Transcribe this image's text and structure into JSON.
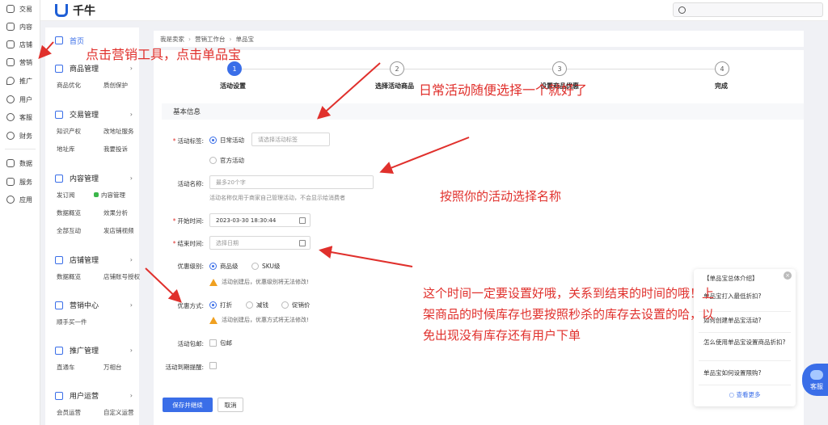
{
  "rail": {
    "items": [
      {
        "label": "交易",
        "icon": "order-icon"
      },
      {
        "label": "内容",
        "icon": "content-icon"
      },
      {
        "label": "店铺",
        "icon": "shop-icon"
      },
      {
        "label": "营销",
        "icon": "megaphone-icon"
      },
      {
        "label": "推广",
        "icon": "location-icon"
      },
      {
        "label": "用户",
        "icon": "user-icon"
      },
      {
        "label": "客服",
        "icon": "headset-icon"
      },
      {
        "label": "财务",
        "icon": "finance-icon"
      },
      {
        "label": "数据",
        "icon": "chart-icon"
      },
      {
        "label": "服务",
        "icon": "grid-icon"
      },
      {
        "label": "应用",
        "icon": "apps-icon"
      }
    ]
  },
  "topbar": {
    "brand": "千牛"
  },
  "menu": {
    "home": "首页",
    "groups": [
      {
        "title": "商品管理",
        "subs": [
          "商品优化",
          "质创保护"
        ]
      },
      {
        "title": "交易管理",
        "subs": [
          "知识产权",
          "改地址服务",
          "地址库",
          "我要投诉"
        ]
      },
      {
        "title": "内容管理",
        "subs": [
          "发订阅",
          "内容管理",
          "数据概览",
          "效果分析",
          "全部互动",
          "发店铺视频"
        ]
      },
      {
        "title": "店铺管理",
        "subs": [
          "数据概览",
          "店铺账号授权"
        ]
      },
      {
        "title": "营销中心",
        "subs": [
          "顺手买一件"
        ]
      },
      {
        "title": "推广管理",
        "subs": [
          "直通车",
          "万相台"
        ]
      },
      {
        "title": "用户运营",
        "subs": [
          "会员运营",
          "自定义运营"
        ]
      }
    ]
  },
  "breadcrumb": [
    "我是卖家",
    "营销工作台",
    "单品宝"
  ],
  "steps": [
    {
      "num": "1",
      "label": "活动设置"
    },
    {
      "num": "2",
      "label": "选择活动商品"
    },
    {
      "num": "3",
      "label": "设置商品优惠"
    },
    {
      "num": "4",
      "label": "完成"
    }
  ],
  "form": {
    "section": "基本信息",
    "tag_label": "活动标签:",
    "tag_opt1": "日常活动",
    "tag_opt2": "官方活动",
    "tag_placeholder": "请选择活动标签",
    "name_label": "活动名称:",
    "name_placeholder": "最多20个字",
    "name_hint": "活动名称仅用于商家自己管理活动，不会显示给消费者",
    "start_label": "开始时间:",
    "start_value": "2023-03-30 18:30:44",
    "end_label": "结束时间:",
    "end_placeholder": "选择日期",
    "level_label": "优惠级别:",
    "level_opt1": "商品级",
    "level_opt2": "SKU级",
    "level_warn": "活动创建后，优惠级别将无法修改!",
    "mode_label": "优惠方式:",
    "mode_opt1": "打折",
    "mode_opt2": "减钱",
    "mode_opt3": "促销价",
    "mode_warn": "活动创建后，优惠方式将无法修改!",
    "ship_label": "活动包邮:",
    "ship_opt": "包邮",
    "remind_label": "活动到期提醒:",
    "save_btn": "保存并继续",
    "cancel_btn": "取消"
  },
  "help": {
    "title": "【单品宝总体介绍】",
    "items": [
      "单品宝打入最低折扣?",
      "如何创建单品宝活动?",
      "怎么使用单品宝设置商品折扣?",
      "单品宝如何设置限购?"
    ],
    "more": "查看更多"
  },
  "kefu": "客服",
  "annotations": {
    "a1": "点击营销工具，点击单品宝",
    "a2": "日常活动随便选择一个就好了",
    "a3": "按照你的活动选择名称",
    "a4_l1": "这个时间一定要设置好哦，关系到结束的时间的哦！上",
    "a4_l2": "架商品的时候库存也要按照秒杀的库存去设置的哈，以",
    "a4_l3": "免出现没有库存还有用户下单"
  },
  "colors": {
    "accent": "#3a6ee8",
    "annotation": "#e0302c",
    "warning": "#f0a020"
  }
}
